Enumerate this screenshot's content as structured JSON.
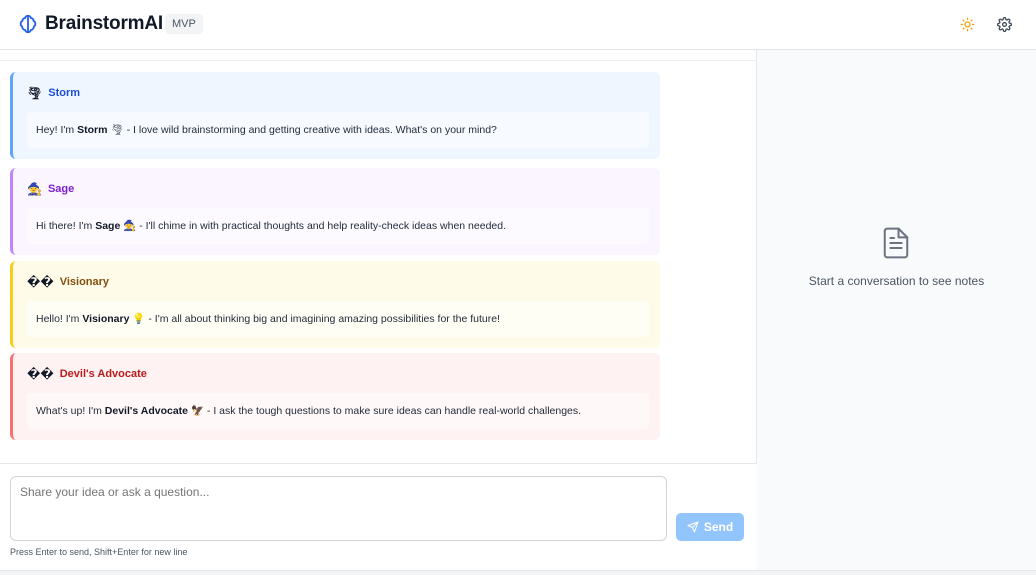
{
  "header": {
    "brand": "BrainstormAI",
    "badge": "MVP",
    "icons": [
      "brain-logo-icon",
      "sun-icon",
      "gear-icon"
    ],
    "accent_color": "#f59e0b"
  },
  "messages": [
    {
      "persona": "Storm",
      "emoji": "🌪",
      "prefix": "Hey! I'm ",
      "name_bold": "Storm",
      "suffix_emoji": "🌪",
      "text": " - I love wild brainstorming and getting creative with ideas. What's on your mind?",
      "color": "#60a5fa"
    },
    {
      "persona": "Sage",
      "emoji": "🧙",
      "prefix": "Hi there! I'm ",
      "name_bold": "Sage",
      "suffix_emoji": "🧙",
      "text": " - I'll chime in with practical thoughts and help reality-check ideas when needed.",
      "color": "#c084fc"
    },
    {
      "persona": "Visionary",
      "emoji": "��",
      "prefix": "Hello! I'm ",
      "name_bold": "Visionary",
      "suffix_emoji": "💡",
      "text": " - I'm all about thinking big and imagining amazing possibilities for the future!",
      "color": "#facc15"
    },
    {
      "persona": "Devil's Advocate",
      "emoji": "��",
      "prefix": "What's up! I'm ",
      "name_bold": "Devil's Advocate",
      "suffix_emoji": "🦅",
      "text": " - I ask the tough questions to make sure ideas can handle real-world challenges.",
      "color": "#f87171"
    }
  ],
  "notes": {
    "empty_text": "Start a conversation to see notes",
    "icon": "document-icon"
  },
  "composer": {
    "placeholder": "Share your idea or ask a question...",
    "send_label": "Send",
    "hint": "Press Enter to send, Shift+Enter for new line"
  }
}
